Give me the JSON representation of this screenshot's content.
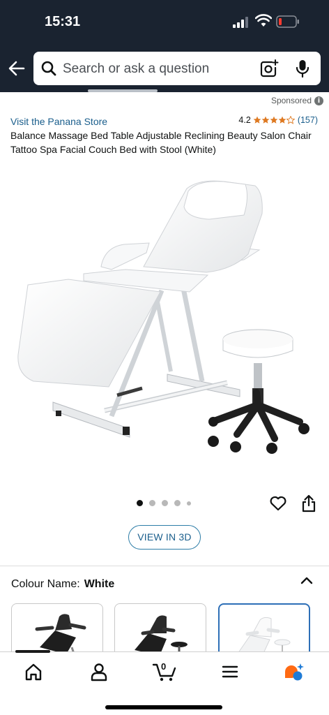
{
  "status_bar": {
    "time": "15:31"
  },
  "search": {
    "placeholder": "Search or ask a question"
  },
  "sponsored": {
    "label": "Sponsored",
    "info_glyph": "i"
  },
  "product": {
    "store_link": "Visit the Panana Store",
    "rating": "4.2",
    "stars": 4.2,
    "review_count": "(157)",
    "title": "Balance Massage Bed Table Adjustable Reclining Beauty Salon Chair Tattoo Spa Facial Couch Bed with Stool (White)"
  },
  "gallery": {
    "total_images": 5,
    "active_index": 0
  },
  "view3d": {
    "label": "VIEW IN 3D"
  },
  "colour": {
    "label": "Colour Name:",
    "value": "White"
  },
  "swatches": [
    {
      "name": "Black chair",
      "selected": false
    },
    {
      "name": "Black chair with stool",
      "selected": false
    },
    {
      "name": "White chair with stool",
      "selected": true
    }
  ],
  "bottom_nav": {
    "items": [
      "home-icon",
      "account-icon",
      "cart-icon",
      "menu-icon",
      "rufus-icon"
    ],
    "cart_count": "0"
  },
  "colors": {
    "header_bg": "#1a2330",
    "link": "#1a5e8c",
    "star": "#de7921",
    "selected_swatch": "#2d6fb7"
  }
}
